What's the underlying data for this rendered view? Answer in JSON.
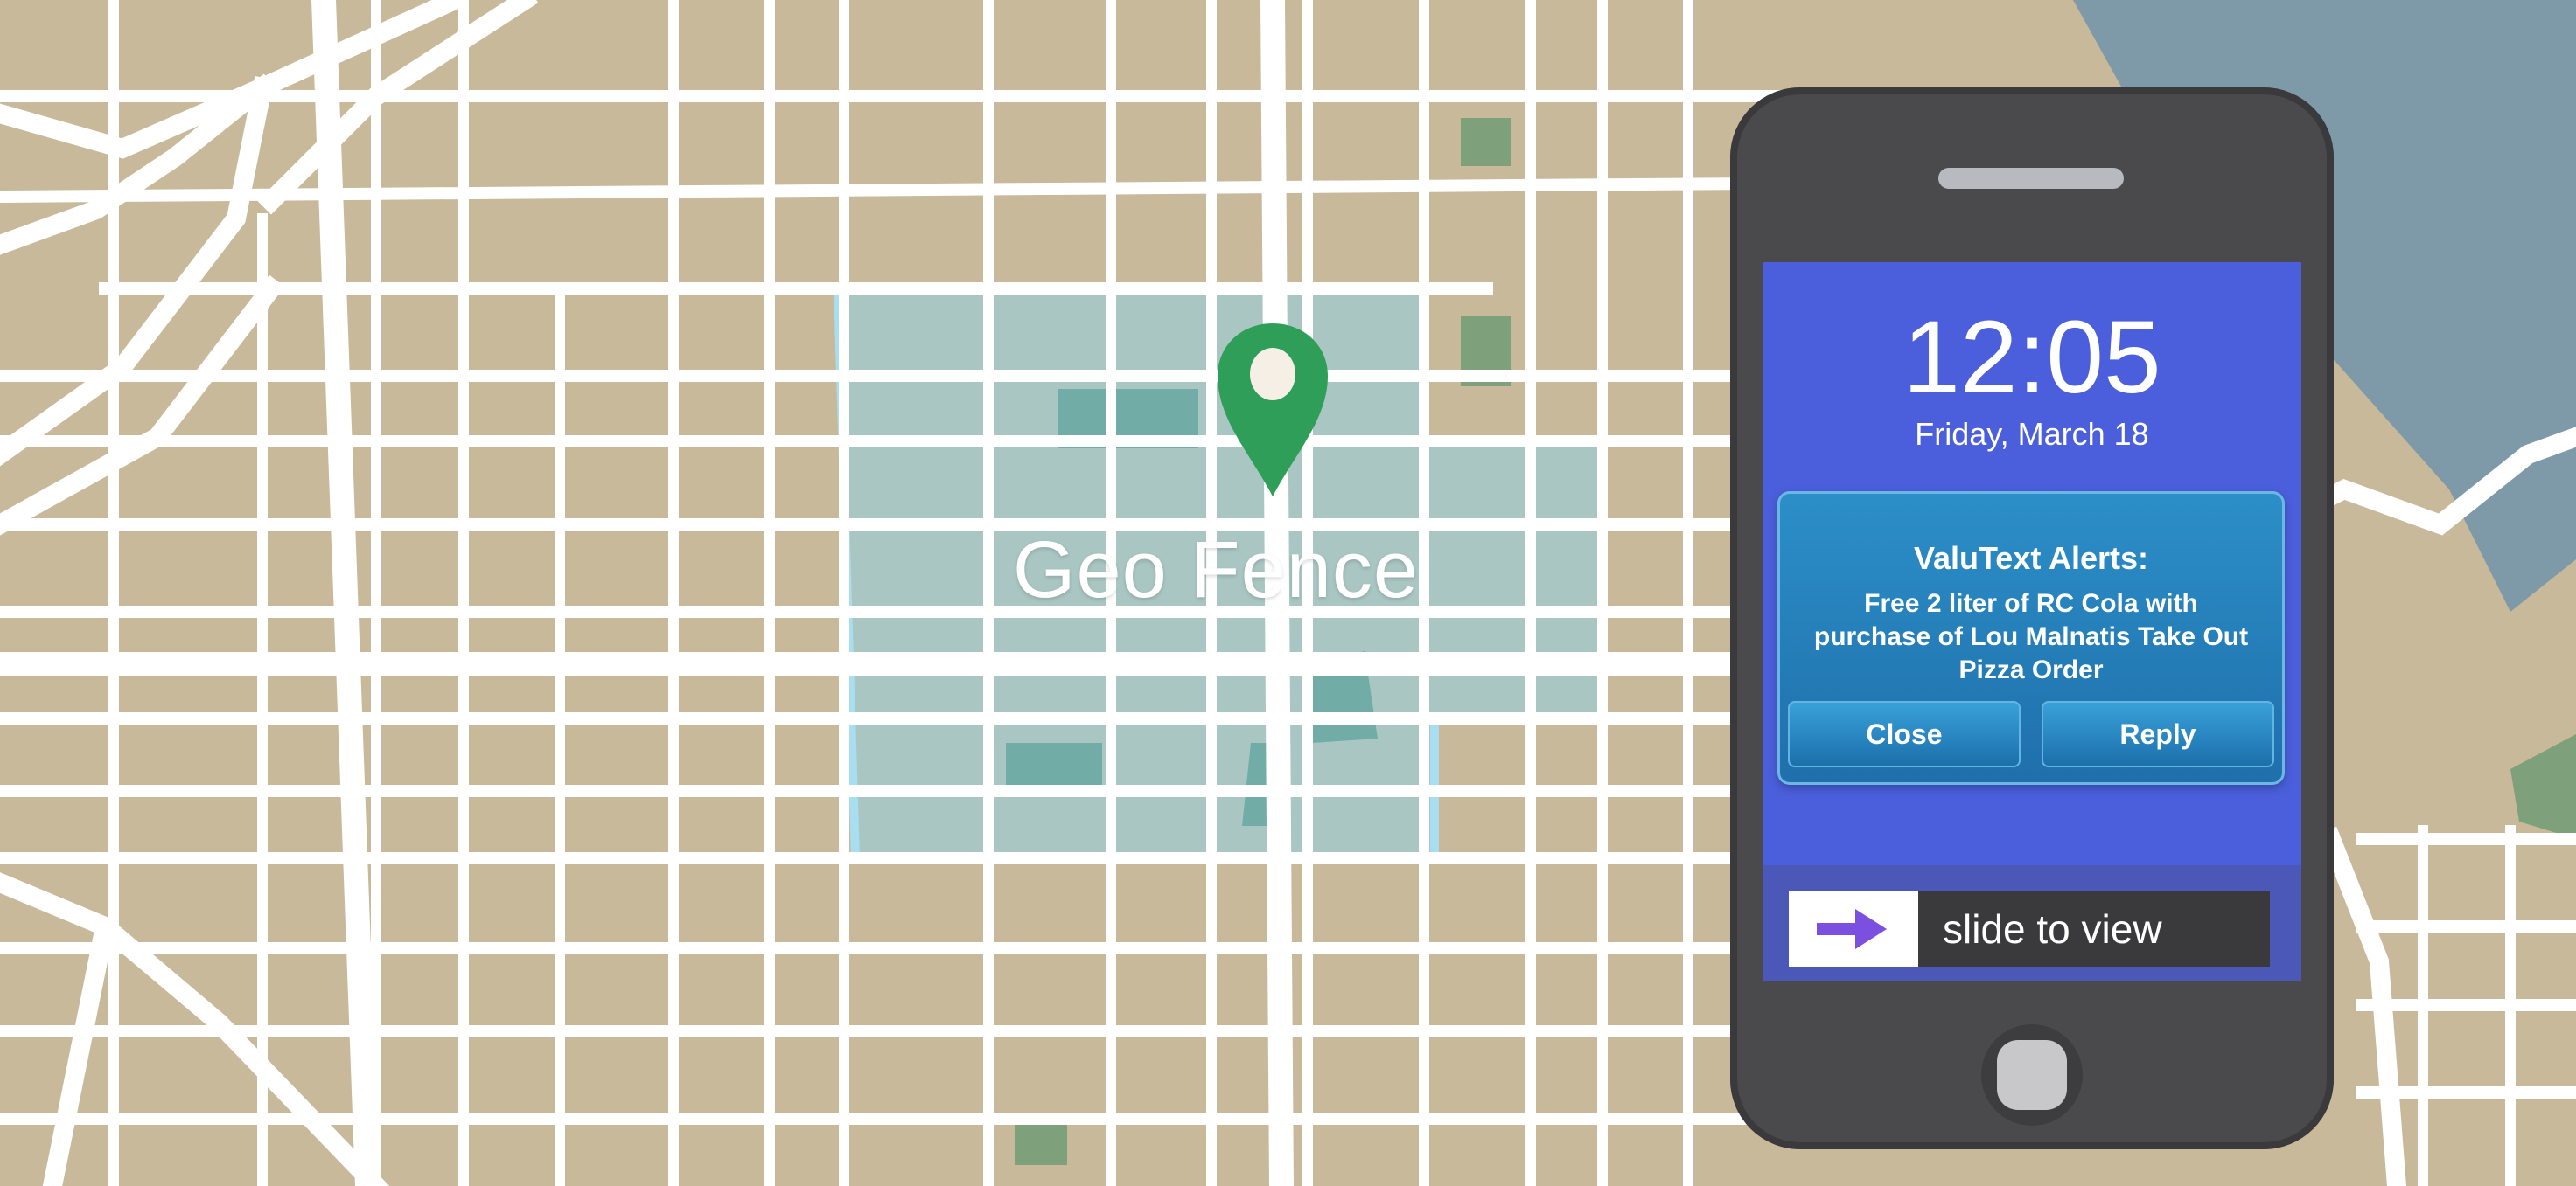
{
  "map": {
    "label": "Geo Fence",
    "colors": {
      "land": "#c7b999",
      "road": "#ffffff",
      "water": "#7e9aa8",
      "park": "#7ea07a",
      "fence": "#8fd2e4"
    }
  },
  "phone": {
    "time": "12:05",
    "date": "Friday, March 18",
    "alert": {
      "title": "ValuText Alerts:",
      "body": "Free 2 liter of RC Cola with purchase of Lou Malnatis Take Out Pizza Order",
      "close_label": "Close",
      "reply_label": "Reply"
    },
    "slider": {
      "label": "slide to view",
      "icon": "arrow-right-icon"
    },
    "colors": {
      "screen": "#4b5fdc",
      "alert": "#2a86c2",
      "arrow": "#7b4fe0"
    }
  }
}
